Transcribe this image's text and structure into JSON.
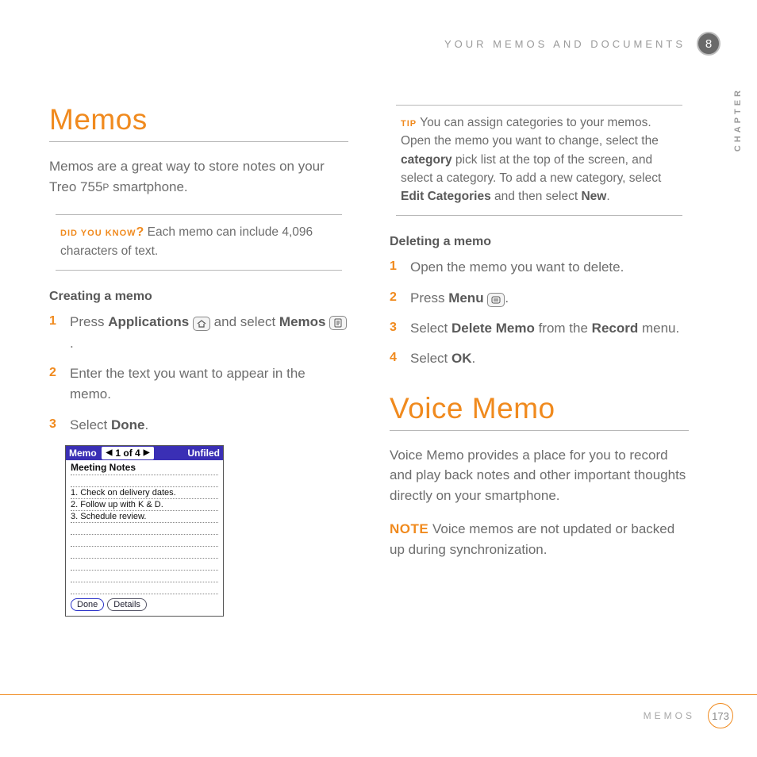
{
  "header": {
    "section": "YOUR MEMOS AND DOCUMENTS",
    "chapter_number": "8",
    "chapter_label": "CHAPTER"
  },
  "left": {
    "h1": "Memos",
    "intro_a": "Memos are a great way to store notes on your Treo 755",
    "intro_small": "P",
    "intro_b": " smartphone.",
    "dyk_label": "DID YOU KNOW",
    "dyk_q": "?",
    "dyk_text": " Each memo can include 4,096 characters of text.",
    "create_head": "Creating a memo",
    "create": [
      {
        "pre": "Press ",
        "b1": "Applications",
        "mid": " ",
        "b2": "Memos",
        "post": " and select ",
        "tail": " ."
      },
      {
        "text": "Enter the text you want to appear in the memo."
      },
      {
        "pre": "Select ",
        "b1": "Done",
        "post": "."
      }
    ],
    "shot": {
      "app": "Memo",
      "nav": "1 of 4",
      "cat": "Unfiled",
      "title": "Meeting Notes",
      "lines": [
        "",
        "1. Check on delivery dates.",
        "2. Follow up with K & D.",
        "3. Schedule review.",
        "",
        "",
        "",
        "",
        "",
        ""
      ],
      "btn_done": "Done",
      "btn_details": "Details"
    }
  },
  "right": {
    "tip_label": "TIP",
    "tip_a": " You can assign categories to your memos. Open the memo you want to change, select the ",
    "tip_b1": "category",
    "tip_b": " pick list at the top of the screen, and select a category. To add a new category, select ",
    "tip_b2": "Edit Categories",
    "tip_c": " and then select ",
    "tip_b3": "New",
    "tip_d": ".",
    "delete_head": "Deleting a memo",
    "delete": [
      {
        "text": "Open the memo you want to delete."
      },
      {
        "pre": "Press ",
        "b1": "Menu",
        "post": " ",
        "icon": true,
        "tail": "."
      },
      {
        "pre": "Select ",
        "b1": "Delete Memo",
        "mid": " from the ",
        "b2": "Record",
        "post": " menu."
      },
      {
        "pre": "Select ",
        "b1": "OK",
        "post": "."
      }
    ],
    "h1": "Voice Memo",
    "vm_intro": "Voice Memo provides a place for you to record and play back notes and other important thoughts directly on your smartphone.",
    "note_label": "NOTE",
    "note_text": " Voice memos are not updated or backed up during synchronization."
  },
  "footer": {
    "label": "MEMOS",
    "page": "173"
  }
}
